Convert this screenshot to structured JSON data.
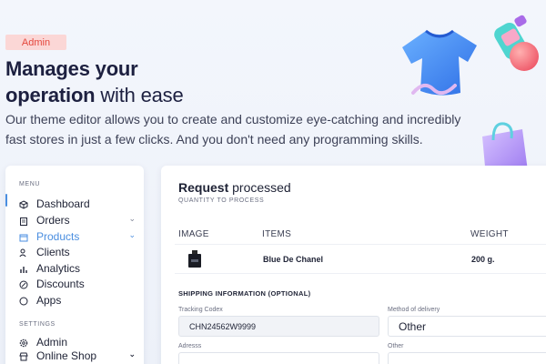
{
  "hero": {
    "badge": "Admin",
    "headline_bold1": "Manages your",
    "headline_bold2": "operation",
    "headline_light": " with ease",
    "lead": "Our theme editor allows you to create and customize eye-catching and incredibly fast stores in just a few clicks. And you don't need any programming skills."
  },
  "sidebar": {
    "menu_title": "MENU",
    "items": [
      {
        "label": "Dashboard",
        "icon": "cube-icon"
      },
      {
        "label": "Orders",
        "icon": "clipboard-icon",
        "chevron": "⌄"
      },
      {
        "label": "Products",
        "icon": "box-icon",
        "chevron": "⌄",
        "active": true
      },
      {
        "label": "Clients",
        "icon": "users-icon"
      },
      {
        "label": "Analytics",
        "icon": "chart-icon"
      },
      {
        "label": "Discounts",
        "icon": "percent-icon"
      },
      {
        "label": "Apps",
        "icon": "circle-icon"
      }
    ],
    "settings_title": "SETTINGS",
    "settings_items": [
      {
        "label": "Admin",
        "icon": "gear-icon"
      },
      {
        "label": "Online Shop",
        "icon": "shop-icon",
        "chevron": "⌄"
      }
    ]
  },
  "card": {
    "title_bold": "Request",
    "title_light": " processed",
    "subtitle": "QUANTITY TO PROCESS",
    "table": {
      "headers": [
        "IMAGE",
        "ITEMS",
        "WEIGHT"
      ],
      "rows": [
        {
          "item": "Blue De Chanel",
          "weight": "200 g."
        }
      ]
    },
    "shipping_title": "SHIPPING INFORMATION (OPTIONAL)",
    "fields": {
      "tracking_label": "Tracking Codex",
      "tracking_value": "CHN24562W9999",
      "delivery_label": "Method of delivery",
      "delivery_value": "Other",
      "address_label": "Adresss",
      "other_label": "Other"
    }
  },
  "colors": {
    "accent": "#4a8ee0",
    "badge_bg": "#fbd7d6",
    "badge_text": "#e4473d"
  }
}
